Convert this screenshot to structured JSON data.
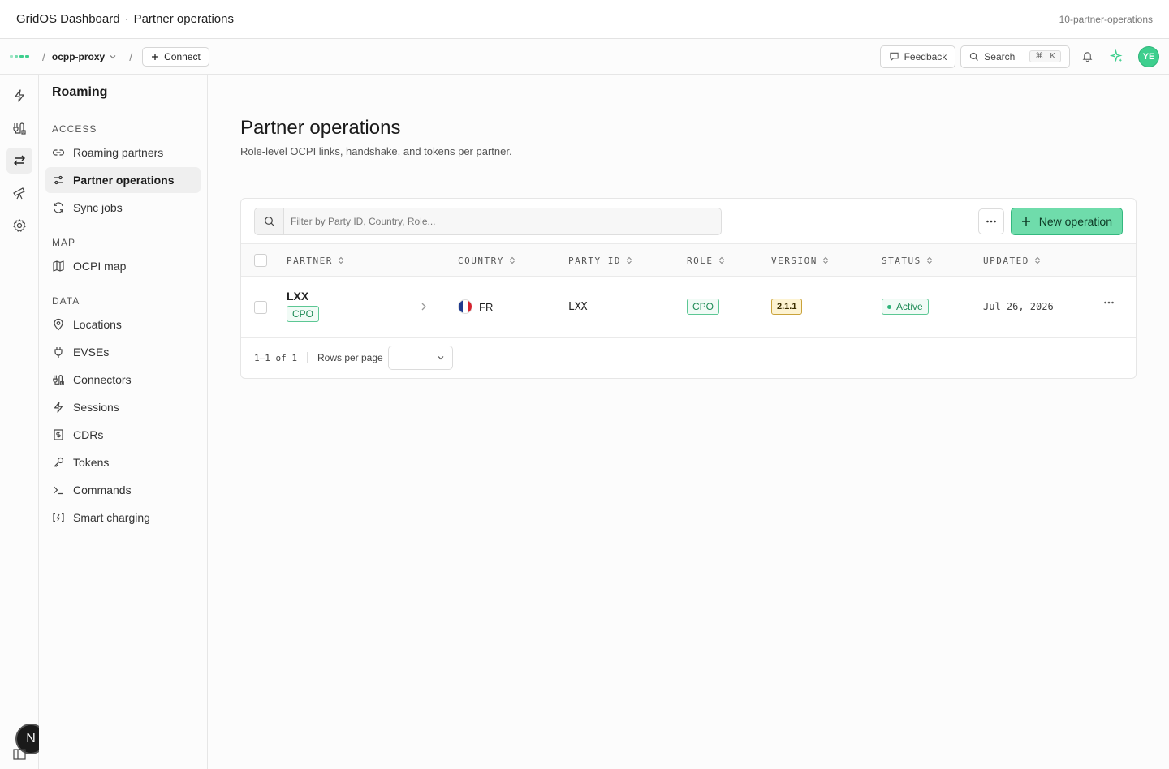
{
  "titlebar": {
    "app": "GridOS Dashboard",
    "separator": "·",
    "page": "Partner operations",
    "slug": "10-partner-operations"
  },
  "topnav": {
    "project": "ocpp-proxy",
    "connect_label": "Connect",
    "feedback_label": "Feedback",
    "search_label": "Search",
    "kbd_cmd": "⌘",
    "kbd_key": "K",
    "avatar_initials": "YE"
  },
  "rail": {
    "bottom_badge": "N"
  },
  "sidebar": {
    "title": "Roaming",
    "groups": [
      {
        "label": "ACCESS",
        "items": [
          "Roaming partners",
          "Partner operations",
          "Sync jobs"
        ]
      },
      {
        "label": "MAP",
        "items": [
          "OCPI map"
        ]
      },
      {
        "label": "DATA",
        "items": [
          "Locations",
          "EVSEs",
          "Connectors",
          "Sessions",
          "CDRs",
          "Tokens",
          "Commands",
          "Smart charging"
        ]
      }
    ]
  },
  "main": {
    "title": "Partner operations",
    "subtitle": "Role-level OCPI links, handshake, and tokens per partner.",
    "filter_placeholder": "Filter by Party ID, Country, Role...",
    "new_button": "New operation",
    "columns": [
      "PARTNER",
      "COUNTRY",
      "PARTY ID",
      "ROLE",
      "VERSION",
      "STATUS",
      "UPDATED"
    ],
    "rows": [
      {
        "partner": "LXX",
        "partner_tag": "CPO",
        "country": "FR",
        "party_id": "LXX",
        "role": "CPO",
        "version": "2.1.1",
        "status": "Active",
        "updated": "Jul 26, 2026"
      }
    ],
    "pagination": {
      "range": "1–1 of 1",
      "rows_per_page_label": "Rows per page"
    }
  },
  "colors": {
    "accent": "#3ecf8e",
    "accent_fill": "#6fdcab",
    "status_active": "#2fb47a",
    "version_tag": "#fdf3d2"
  }
}
